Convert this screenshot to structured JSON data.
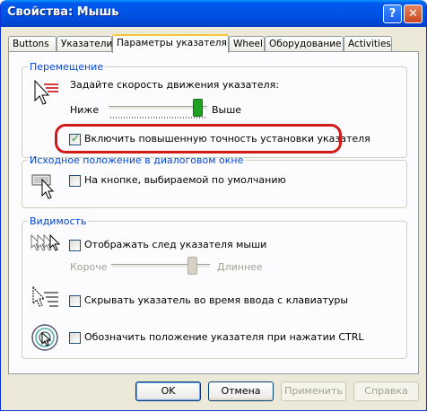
{
  "window": {
    "title": "Свойства: Мышь",
    "help_glyph": "?",
    "close_glyph": "✕"
  },
  "tabs": [
    {
      "label": "Buttons"
    },
    {
      "label": "Указатели"
    },
    {
      "label": "Параметры указателя"
    },
    {
      "label": "Wheel"
    },
    {
      "label": "Оборудование"
    },
    {
      "label": "Activities"
    }
  ],
  "motion": {
    "legend": "Перемещение",
    "prompt": "Задайте скорость движения указателя:",
    "slow": "Ниже",
    "fast": "Выше",
    "speed_level": 0.9,
    "precision_label": "Включить повышенную точность установки указателя",
    "precision_checked": true
  },
  "snap": {
    "legend": "Исходное положение в диалоговом окне",
    "label": "На кнопке, выбираемой по умолчанию",
    "checked": false
  },
  "visibility": {
    "legend": "Видимость",
    "trails_label": "Отображать след указателя мыши",
    "trails_checked": false,
    "short": "Короче",
    "long": "Длиннее",
    "trail_level": 0.82,
    "hide_label": "Скрывать указатель во время ввода с клавиатуры",
    "hide_checked": false,
    "ctrl_label": "Обозначить положение указателя при нажатии CTRL",
    "ctrl_checked": false
  },
  "buttons": {
    "ok": "OK",
    "cancel": "Отмена",
    "apply": "Применить",
    "help": "Справка"
  },
  "colors": {
    "accent": "#0046d5",
    "highlight": "#d11a1a",
    "check": "#21a121"
  }
}
